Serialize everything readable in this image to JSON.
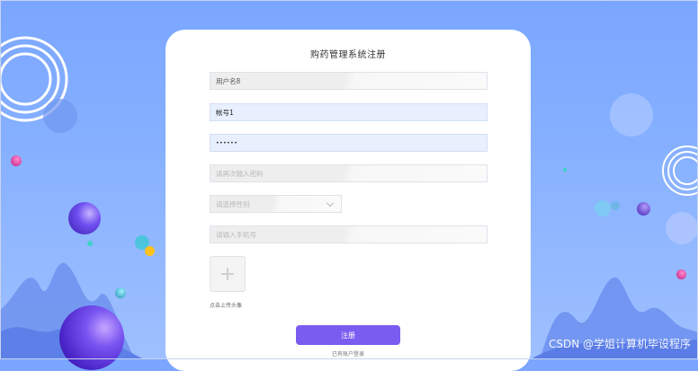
{
  "form": {
    "title": "购药管理系统注册",
    "username_value": "用户名8",
    "account_value": "帐号1",
    "password_mask": "••••••",
    "confirm_password_placeholder": "请再次输入密码",
    "gender_placeholder": "请选择性别",
    "phone_placeholder": "请输入手机号",
    "avatar_upload_label": "点击上传头像",
    "register_button": "注册",
    "login_link": "已有账户登录"
  },
  "watermark": "CSDN @学姐计算机毕设程序",
  "colors": {
    "background": "#86b0ff",
    "accent": "#7a5cf0",
    "filled_field": "#e8f0fe"
  },
  "icons": [
    "plus-icon",
    "chevron-down-icon"
  ]
}
